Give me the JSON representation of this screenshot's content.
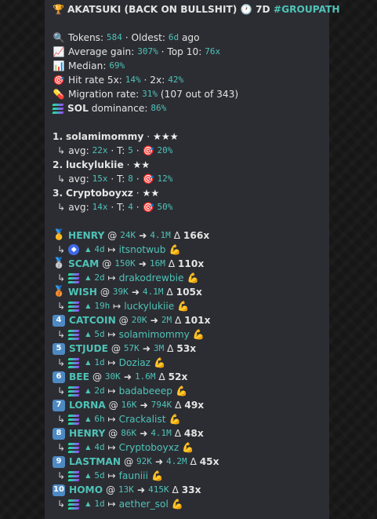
{
  "header": {
    "trophy": "🏆",
    "title": "AKATSUKI (BACK ON BULLSHIT)",
    "clock": "🕐",
    "period": "7D",
    "hashtag": "#GROUPATH"
  },
  "stats": {
    "tokens_label": "Tokens:",
    "tokens_value": "584",
    "oldest_label": "· Oldest:",
    "oldest_value": "6d",
    "oldest_suffix": "ago",
    "avg_label": "Average gain:",
    "avg_value": "307%",
    "top10_label": "· Top 10:",
    "top10_value": "76x",
    "median_label": "Median:",
    "median_value": "69%",
    "hitrate_label": "Hit rate 5x:",
    "hitrate5_value": "14%",
    "hitrate2_label": "· 2x:",
    "hitrate2_value": "42%",
    "migration_label": "Migration rate:",
    "migration_value": "31%",
    "migration_note": "(107 out of 343)",
    "sol_label": "SOL",
    "dominance_label": "dominance:",
    "dominance_value": "86%"
  },
  "rankers": [
    {
      "rank": "1.",
      "name": "solamimommy",
      "stars": "★★★",
      "avg": "22x",
      "t": "5",
      "hit": "20%"
    },
    {
      "rank": "2.",
      "name": "luckylukiie",
      "stars": "★★",
      "avg": "15x",
      "t": "8",
      "hit": "12%"
    },
    {
      "rank": "3.",
      "name": "Cryptoboyxz",
      "stars": "★★",
      "avg": "14x",
      "t": "4",
      "hit": "50%"
    }
  ],
  "labels": {
    "avg": "avg:",
    "t": "T:",
    "sep": "·",
    "at": "@",
    "delta": "Δ",
    "arrow": "➜",
    "mapsto": "↦",
    "hook": "↳",
    "strong": "💪",
    "target": "🎯",
    "tri": "▲"
  },
  "tokens": [
    {
      "badge": "🥇",
      "badge_type": "medal",
      "name": "HENRY",
      "from": "24K",
      "to": "4.1M",
      "mult": "166x",
      "chain": "eth",
      "age": "4d",
      "caller": "itsnotwub"
    },
    {
      "badge": "🥈",
      "badge_type": "medal",
      "name": "SCAM",
      "from": "150K",
      "to": "16M",
      "mult": "110x",
      "chain": "sol",
      "age": "2d",
      "caller": "drakodrewbie"
    },
    {
      "badge": "🥉",
      "badge_type": "medal",
      "name": "WISH",
      "from": "39K",
      "to": "4.1M",
      "mult": "105x",
      "chain": "sol",
      "age": "19h",
      "caller": "luckylukiie"
    },
    {
      "badge": "4",
      "badge_type": "keycap",
      "name": "CATCOIN",
      "from": "20K",
      "to": "2M",
      "mult": "101x",
      "chain": "sol",
      "age": "5d",
      "caller": "solamimommy"
    },
    {
      "badge": "5",
      "badge_type": "keycap",
      "name": "STJUDE",
      "from": "57K",
      "to": "3M",
      "mult": "53x",
      "chain": "sol",
      "age": "1d",
      "caller": "Doziaz"
    },
    {
      "badge": "6",
      "badge_type": "keycap",
      "name": "BEE",
      "from": "30K",
      "to": "1.6M",
      "mult": "52x",
      "chain": "sol",
      "age": "2d",
      "caller": "badabeeep"
    },
    {
      "badge": "7",
      "badge_type": "keycap",
      "name": "LORNA",
      "from": "16K",
      "to": "794K",
      "mult": "49x",
      "chain": "sol",
      "age": "6h",
      "caller": "Crackalist"
    },
    {
      "badge": "8",
      "badge_type": "keycap",
      "name": "HENRY",
      "from": "86K",
      "to": "4.1M",
      "mult": "48x",
      "chain": "sol",
      "age": "4d",
      "caller": "Cryptoboyxz"
    },
    {
      "badge": "9",
      "badge_type": "keycap",
      "name": "LASTMAN",
      "from": "92K",
      "to": "4.2M",
      "mult": "45x",
      "chain": "sol",
      "age": "5d",
      "caller": "fauniii"
    },
    {
      "badge": "10",
      "badge_type": "keycap",
      "name": "HOMO",
      "from": "13K",
      "to": "415K",
      "mult": "33x",
      "chain": "sol",
      "age": "1d",
      "caller": "aether_sol"
    }
  ],
  "colors": {
    "accent": "#4fc3b7",
    "bubble": "#2c2d33",
    "keycap": "#4d8ac4"
  }
}
